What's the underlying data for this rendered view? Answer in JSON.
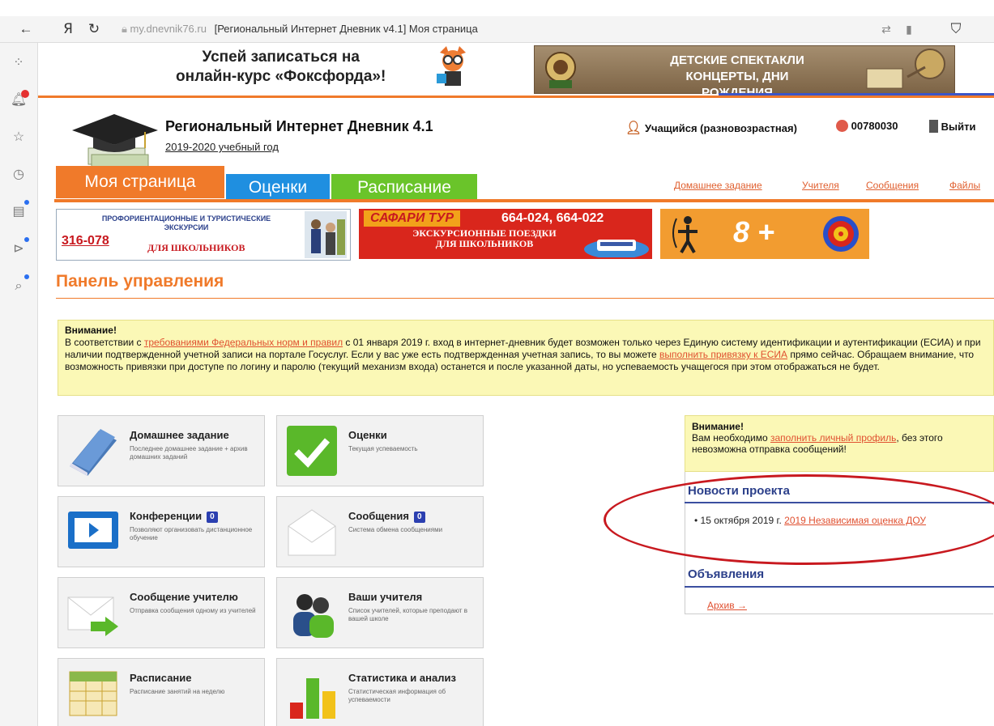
{
  "browser": {
    "domain": "my.dnevnik76.ru",
    "title": "[Региональный Интернет Дневник v4.1] Моя страница"
  },
  "ads": {
    "foxford_line1": "Успей записаться на",
    "foxford_line2": "онлайн-курс «Фоксфорда»!",
    "kids_line1": "ДЕТСКИЕ СПЕКТАКЛИ",
    "kids_line2": "КОНЦЕРТЫ, ДНИ РОЖДЕНИЯ",
    "tour_line1": "ПРОФОРИЕНТАЦИОННЫЕ И ТУРИСТИЧЕСКИЕ",
    "tour_line2": "ЭКСКУРСИИ",
    "tour_phone": "316-078",
    "tour_line3": "ДЛЯ ШКОЛЬНИКОВ",
    "safari_brand": "САФАРИ ТУР",
    "safari_phone": "664-024, 664-022",
    "safari_line1": "ЭКСКУРСИОННЫЕ ПОЕЗДКИ",
    "safari_line2": "ДЛЯ ШКОЛЬНИКОВ",
    "archery_text": "8 +"
  },
  "header": {
    "title": "Региональный Интернет Дневник 4.1",
    "year": "2019-2020 учебный год",
    "user": "Учащийся (разновозрастная)",
    "id": "00780030",
    "logout": "Выйти"
  },
  "tabs": [
    "Моя страница",
    "Оценки",
    "Расписание"
  ],
  "top_links": [
    "Домашнее задание",
    "Учителя",
    "Сообщения",
    "Файлы"
  ],
  "panel_title": "Панель управления",
  "notice": {
    "title": "Внимание!",
    "p1": "В соответствии с ",
    "link1": "требованиями Федеральных норм и правил",
    "p2": " с 01 января 2019 г. вход в интернет-дневник будет возможен только через Единую систему идентификации и аутентификации (ЕСИА) и при наличии подтвержденной учетной записи на портале Госуслуг. Если у вас уже есть подтвержденная учетная запись, то вы можете ",
    "link2": "выполнить привязку к ЕСИА",
    "p3": " прямо сейчас. Обращаем внимание, что возможность привязки при доступе по логину и паролю (текущий механизм входа) останется и после указанной даты, но успеваемость учащегося при этом отображаться не будет."
  },
  "tiles": [
    {
      "title": "Домашнее задание",
      "desc": "Последнее домашнее задание + архив домашних заданий",
      "badge": ""
    },
    {
      "title": "Оценки",
      "desc": "Текущая успеваемость",
      "badge": ""
    },
    {
      "title": "Конференции",
      "desc": "Позволяют организовать дистанционное обучение",
      "badge": "0"
    },
    {
      "title": "Сообщения",
      "desc": "Система обмена сообщениями",
      "badge": "0"
    },
    {
      "title": "Сообщение учителю",
      "desc": "Отправка сообщения одному из учителей",
      "badge": ""
    },
    {
      "title": "Ваши учителя",
      "desc": "Список учителей, которые преподают в вашей школе",
      "badge": ""
    },
    {
      "title": "Расписание",
      "desc": "Расписание занятий на неделю",
      "badge": ""
    },
    {
      "title": "Статистика и анализ",
      "desc": "Статистическая информация об успеваемости",
      "badge": ""
    }
  ],
  "right": {
    "warn_title": "Внимание!",
    "warn_p1": "Вам необходимо ",
    "warn_link": "заполнить личный профиль",
    "warn_p2": ", без этого невозможна отправка сообщений!",
    "news_title": "Новости проекта",
    "news_date": "15 октября 2019 г.",
    "news_link": "2019 Независимая оценка ДОУ",
    "ads_title": "Объявления",
    "archive": "Архив →"
  }
}
